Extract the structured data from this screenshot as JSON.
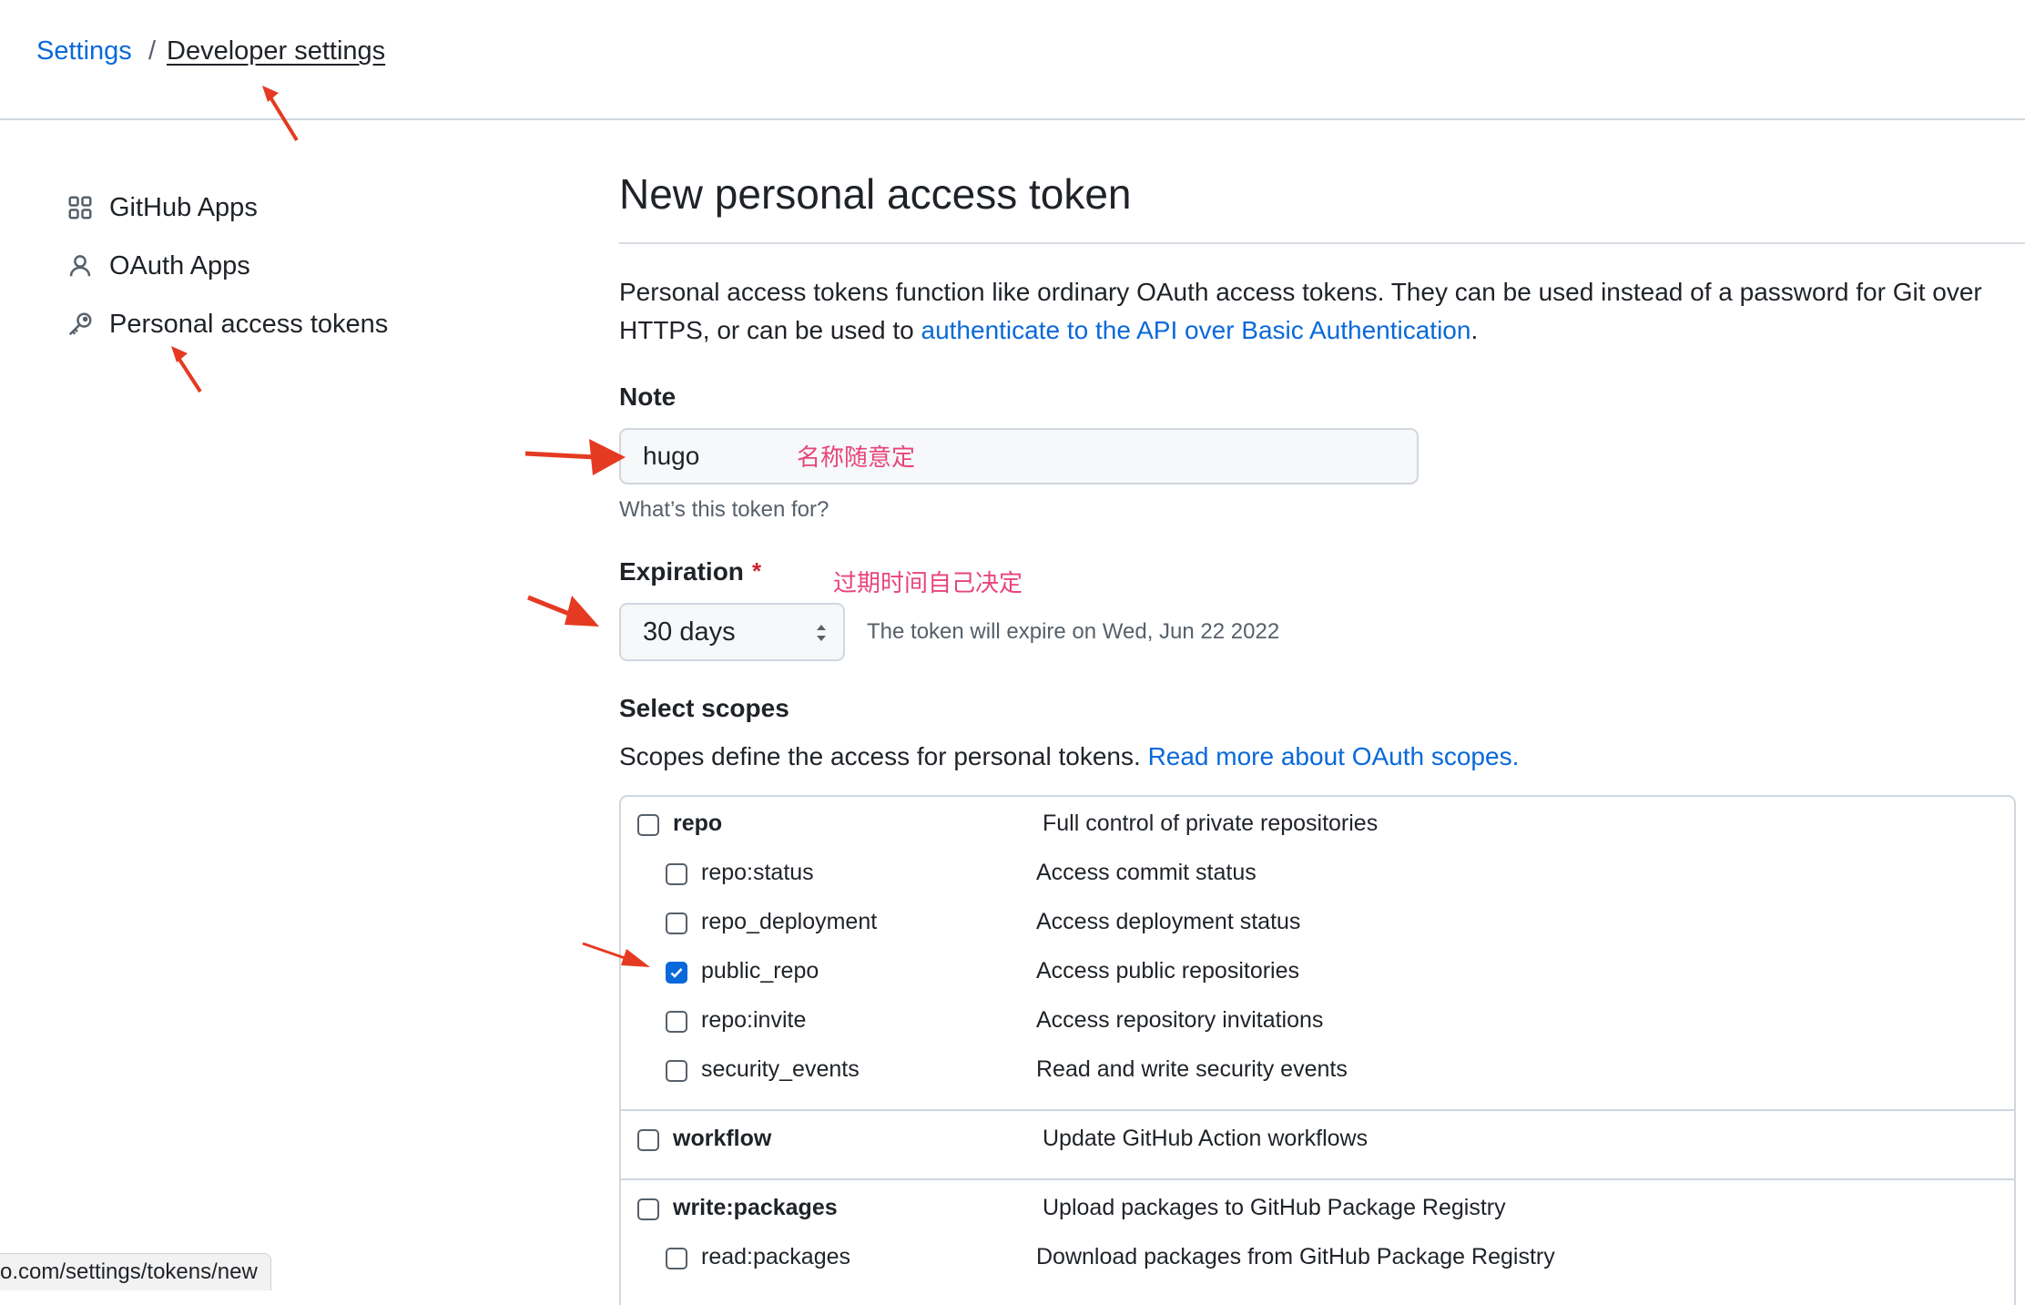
{
  "breadcrumb": {
    "root": "Settings",
    "separator": "/",
    "current": "Developer settings"
  },
  "sidebar": {
    "items": [
      {
        "label": "GitHub Apps",
        "icon": "apps-grid-icon"
      },
      {
        "label": "OAuth Apps",
        "icon": "person-icon"
      },
      {
        "label": "Personal access tokens",
        "icon": "key-icon"
      }
    ]
  },
  "main": {
    "title": "New personal access token",
    "intro_text": "Personal access tokens function like ordinary OAuth access tokens. They can be used instead of a password for Git over HTTPS, or can be used to ",
    "intro_link": "authenticate to the API over Basic Authentication",
    "intro_end": "."
  },
  "note": {
    "label": "Note",
    "value": "hugo",
    "annotation": "名称随意定",
    "help": "What’s this token for?"
  },
  "expiration": {
    "label": "Expiration",
    "required_mark": "*",
    "annotation": "过期时间自己决定",
    "selected": "30 days",
    "note": "The token will expire on Wed, Jun 22 2022"
  },
  "scopes": {
    "label": "Select scopes",
    "description": "Scopes define the access for personal tokens. ",
    "description_link": "Read more about OAuth scopes.",
    "items": [
      {
        "name": "repo",
        "desc": "Full control of private repositories",
        "checked": false,
        "parent": true
      },
      {
        "name": "repo:status",
        "desc": "Access commit status",
        "checked": false,
        "parent": false
      },
      {
        "name": "repo_deployment",
        "desc": "Access deployment status",
        "checked": false,
        "parent": false
      },
      {
        "name": "public_repo",
        "desc": "Access public repositories",
        "checked": true,
        "parent": false
      },
      {
        "name": "repo:invite",
        "desc": "Access repository invitations",
        "checked": false,
        "parent": false
      },
      {
        "name": "security_events",
        "desc": "Read and write security events",
        "checked": false,
        "parent": false
      },
      {
        "name": "workflow",
        "desc": "Update GitHub Action workflows",
        "checked": false,
        "parent": true
      },
      {
        "name": "write:packages",
        "desc": "Upload packages to GitHub Package Registry",
        "checked": false,
        "parent": true
      },
      {
        "name": "read:packages",
        "desc": "Download packages from GitHub Package Registry",
        "checked": false,
        "parent": false
      }
    ]
  },
  "status_bar": {
    "url": "o.com/settings/tokens/new"
  },
  "colors": {
    "link": "#0969da",
    "annotation_text": "#e8457a",
    "annotation_arrow": "#e53a22",
    "checkbox_checked": "#0969da"
  }
}
